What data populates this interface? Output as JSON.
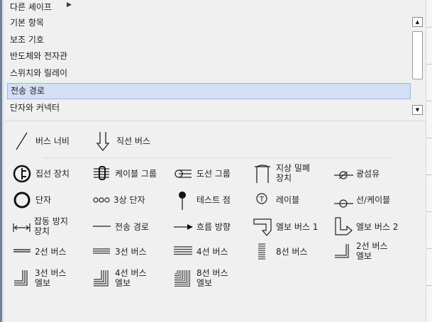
{
  "menu_top": {
    "label": "다른 셰이프"
  },
  "list": {
    "items": [
      {
        "label": "기본 항목"
      },
      {
        "label": "보조 기호"
      },
      {
        "label": "반도체와 전자관"
      },
      {
        "label": "스위치와 릴레이"
      },
      {
        "label": "전송 경로",
        "selected": true
      },
      {
        "label": "단자와 커넥터"
      }
    ]
  },
  "shapes": {
    "bus_width": "버스 너비",
    "straight_bus": "직선 버스",
    "bundle_device": "집선 장치",
    "cable_group": "케이블 그룹",
    "conductor_group": "도선 그룹",
    "ground_seal_l1": "지상 밀폐",
    "ground_seal_l2": "장치",
    "optical_fiber": "광섬유",
    "terminal": "단자",
    "three_phase_terminal": "3상 단자",
    "test_point": "테스트 점",
    "label": "레이블",
    "line_cable": "선/케이블",
    "anti_jam_l1": "잡동 방지",
    "anti_jam_l2": "장치",
    "transmission_path": "전송 경로",
    "flow_direction": "흐름 방향",
    "elbow_bus_1": "엘보 버스 1",
    "elbow_bus_2": "엘보 버스 2",
    "bus_2line": "2선 버스",
    "bus_3line": "3선 버스",
    "bus_4line": "4선 버스",
    "bus_8line": "8선 버스",
    "elbow_2line_l1": "2선 버스",
    "elbow_2line_l2": "엘보",
    "elbow_3line_l1": "3선 버스",
    "elbow_3line_l2": "엘보",
    "elbow_4line_l1": "4선 버스",
    "elbow_4line_l2": "엘보",
    "elbow_8line_l1": "8선 버스",
    "elbow_8line_l2": "엘보"
  }
}
